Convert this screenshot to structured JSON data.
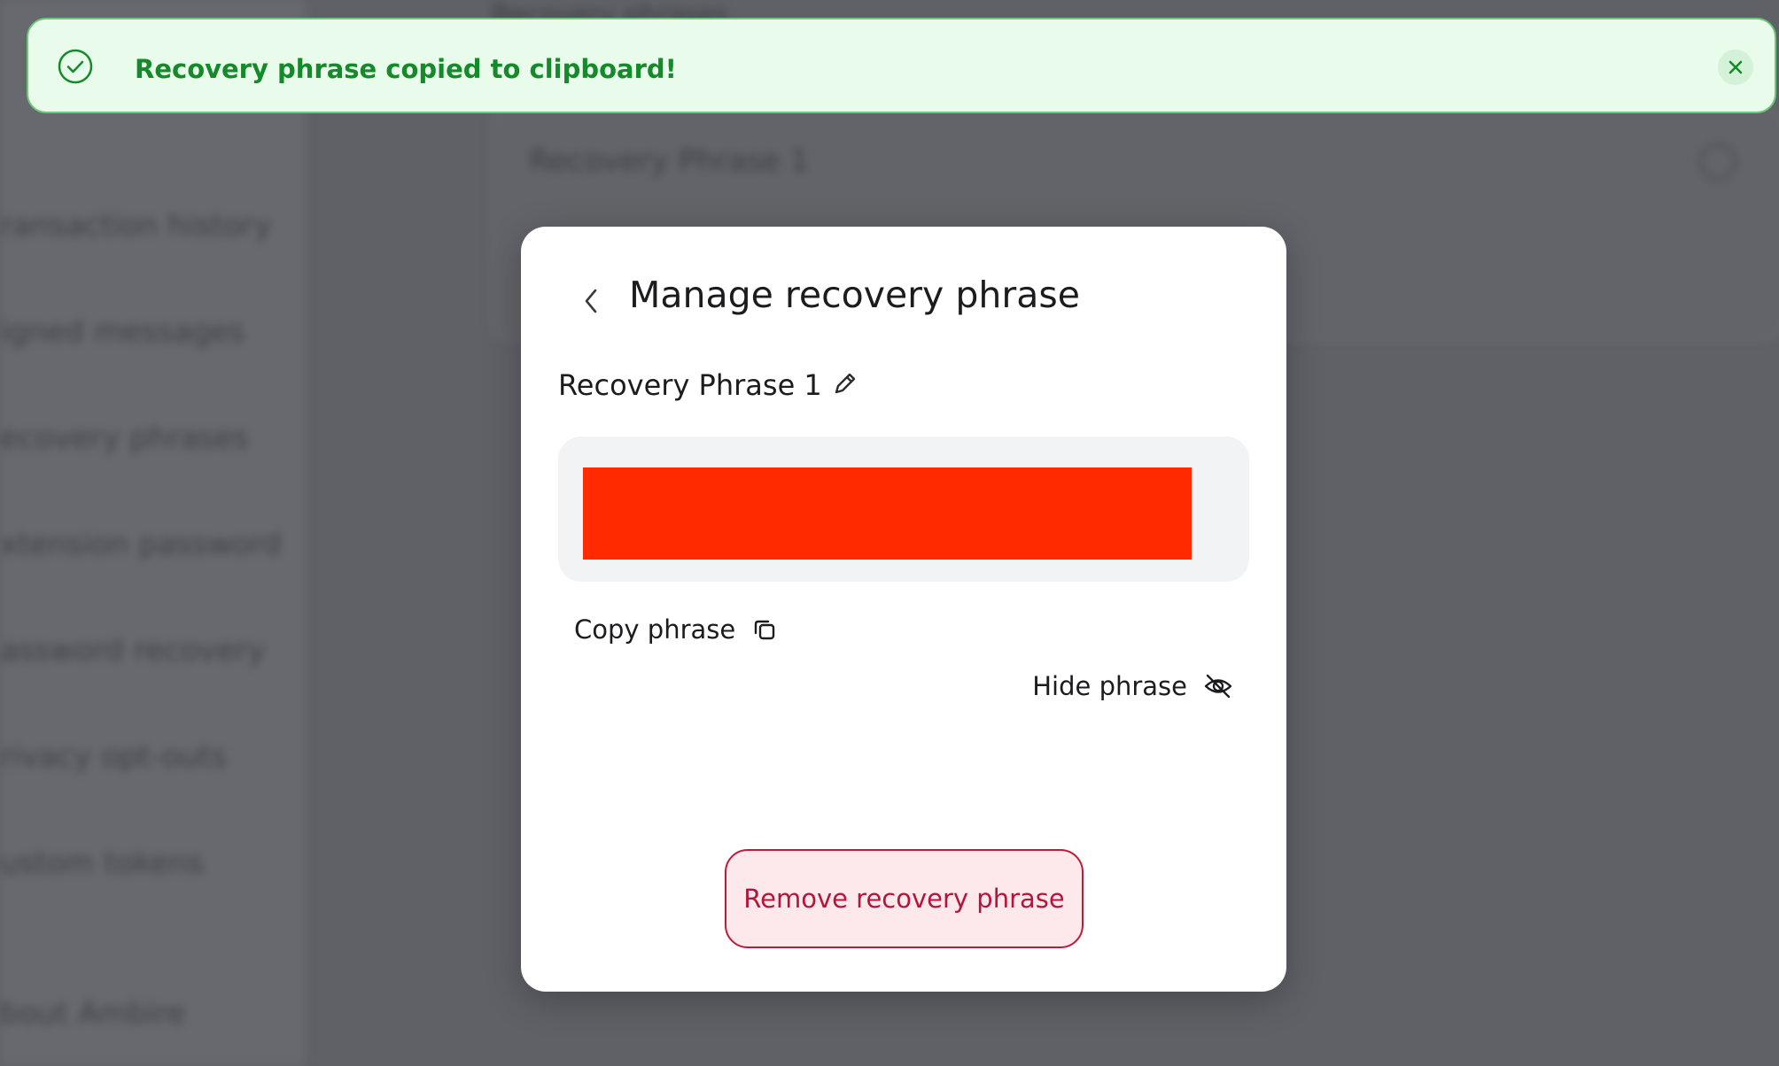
{
  "background": {
    "header_title": "Recovery phrases",
    "sidebar_items": [
      "ransaction history",
      "igned messages",
      "ecovery phrases",
      "xtension password",
      "assword recovery",
      "rivacy opt-outs",
      "ustom tokens",
      "bout Ambire"
    ],
    "card_title": "Recovery Phrase 1"
  },
  "toast": {
    "message": "Recovery phrase copied to clipboard!",
    "icon": "check-circle-icon",
    "close_icon": "close-icon",
    "color": "#158a2a"
  },
  "modal": {
    "title": "Manage recovery phrase",
    "back_icon": "chevron-left-icon",
    "phrase_name": "Recovery Phrase 1",
    "edit_icon": "pencil-icon",
    "copy_label": "Copy phrase",
    "copy_icon": "copy-icon",
    "hide_label": "Hide phrase",
    "hide_icon": "eye-off-icon",
    "remove_label": "Remove recovery phrase",
    "redaction_color": "#ff2a00",
    "danger_color": "#b5153a"
  }
}
